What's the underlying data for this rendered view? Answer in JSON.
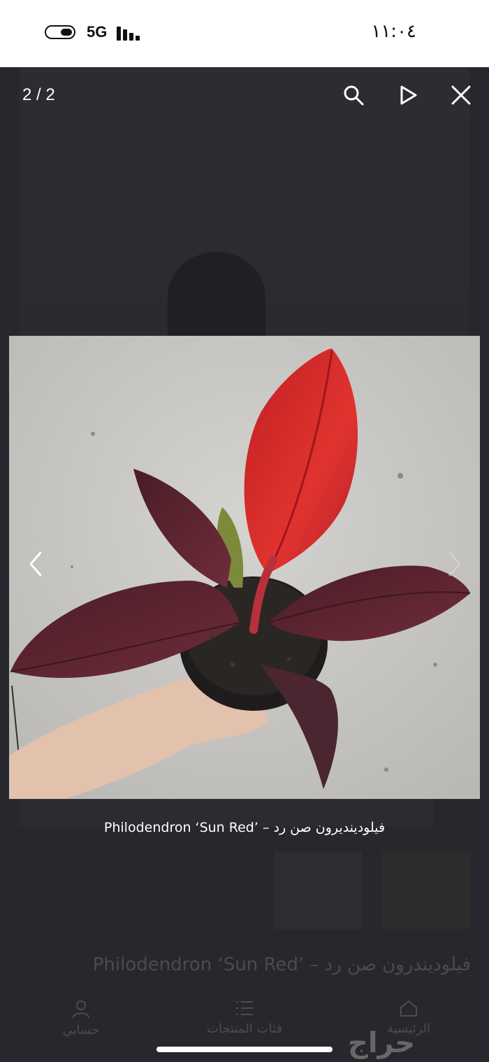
{
  "status_bar": {
    "network": "5G",
    "time": "١١:٠٤"
  },
  "viewer": {
    "counter": "2 / 2",
    "caption": "Philodendron ‘Sun Red’ – فيلودينديرون صن رد",
    "tools": [
      "search-icon",
      "play-icon",
      "close-icon"
    ]
  },
  "background_page": {
    "title": "Philodendron ‘Sun Red’ – فيلوديندرون صن رد",
    "nav": {
      "account": "حسابي",
      "categories": "فئات المنتجات",
      "home": "الرئيسية"
    },
    "logo": "حراج"
  },
  "colors": {
    "leaf_red": "#d42a2a",
    "leaf_burgundy": "#5a2530",
    "wall": "#c9c8c5"
  }
}
